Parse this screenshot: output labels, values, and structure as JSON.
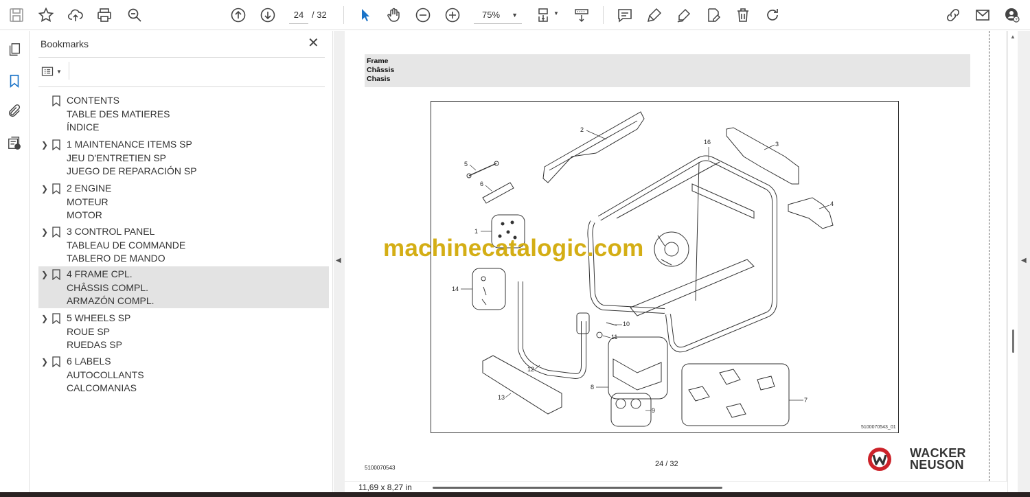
{
  "toolbar": {
    "current_page": "24",
    "total_pages": "/ 32",
    "zoom": "75%",
    "left_icons": [
      "save-icon",
      "star-icon",
      "upload-cloud-icon",
      "print-icon",
      "zoom-search-icon"
    ],
    "nav_icons": [
      "arrow-up-circle-icon",
      "arrow-down-circle-icon"
    ],
    "tool_icons": [
      "select-cursor-icon",
      "hand-icon",
      "zoom-out-icon",
      "zoom-in-icon"
    ],
    "view_icons": [
      "page-fit-icon",
      "scroll-mode-icon"
    ],
    "annotation_icons": [
      "comment-icon",
      "highlight-pen-icon",
      "signature-pen-icon",
      "fill-sign-icon",
      "trash-icon",
      "rotate-icon"
    ],
    "right_icons": [
      "share-link-icon",
      "mail-icon",
      "account-help-icon"
    ]
  },
  "rail": {
    "icons": [
      "pages-thumbnails-icon",
      "bookmark-icon",
      "attachment-icon",
      "document-properties-icon"
    ]
  },
  "bookmarks": {
    "title": "Bookmarks",
    "items": [
      {
        "lines": [
          "CONTENTS",
          "TABLE DES MATIERES",
          "ÍNDICE"
        ],
        "expandable": false,
        "selected": false
      },
      {
        "lines": [
          "1 MAINTENANCE ITEMS SP",
          "JEU D'ENTRETIEN SP",
          "JUEGO DE REPARACIÓN SP"
        ],
        "expandable": true,
        "selected": false
      },
      {
        "lines": [
          "2 ENGINE",
          "MOTEUR",
          "MOTOR"
        ],
        "expandable": true,
        "selected": false
      },
      {
        "lines": [
          "3 CONTROL PANEL",
          "TABLEAU DE COMMANDE",
          "TABLERO DE MANDO"
        ],
        "expandable": true,
        "selected": false
      },
      {
        "lines": [
          "4 FRAME CPL.",
          "CHÂSSIS COMPL.",
          "ARMAZÓN COMPL."
        ],
        "expandable": true,
        "selected": true
      },
      {
        "lines": [
          "5 WHEELS SP",
          "ROUE SP",
          "RUEDAS SP"
        ],
        "expandable": true,
        "selected": false
      },
      {
        "lines": [
          "6 LABELS",
          "AUTOCOLLANTS",
          "CALCOMANIAS"
        ],
        "expandable": true,
        "selected": false
      }
    ]
  },
  "document": {
    "section_title": [
      "Frame",
      "Châssis",
      "Chasis"
    ],
    "callouts": [
      "1",
      "2",
      "3",
      "4",
      "5",
      "6",
      "7",
      "8",
      "9",
      "10",
      "11",
      "12",
      "13",
      "14",
      "16"
    ],
    "figure_id": "5100070543_01",
    "watermark": "machinecatalogic.com",
    "doc_number": "5100070543",
    "page_footer": "24 / 32",
    "brand": [
      "WACKER",
      "NEUSON"
    ],
    "brand_color": "#cc2229"
  },
  "status": {
    "page_size": "11,69 x 8,27 in"
  },
  "colors": {
    "watermark": "#d4ae15",
    "selected_bookmark_bg": "#e3e3e3",
    "accent_blue": "#1a73c8"
  }
}
